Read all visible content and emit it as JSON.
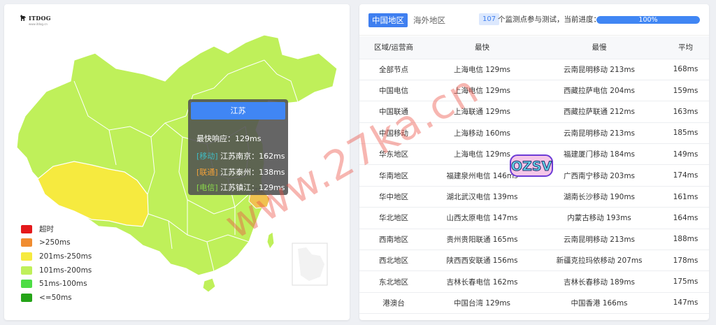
{
  "logo": {
    "name": "ITDOG",
    "sub": "www.itdog.cn"
  },
  "map": {
    "region_label": "江苏",
    "region_level_colors": {
      "default": "#bff05a",
      "tibet_qinghai": "#f6ea3f",
      "jiangsu": "#f0c250"
    }
  },
  "tooltip": {
    "title": "江苏",
    "fastest": "最快响应：129ms",
    "lines": [
      {
        "tag": "[移动]",
        "text": "江苏南京：162ms"
      },
      {
        "tag": "[联通]",
        "text": "江苏泰州：138ms"
      },
      {
        "tag": "[电信]",
        "text": "江苏镇江：129ms"
      }
    ]
  },
  "legend": [
    {
      "label": "超时",
      "color": "#e4191b"
    },
    {
      "label": ">250ms",
      "color": "#f08c30"
    },
    {
      "label": "201ms-250ms",
      "color": "#f6ea3f"
    },
    {
      "label": "101ms-200ms",
      "color": "#bff05a"
    },
    {
      "label": "51ms-100ms",
      "color": "#4ddd45"
    },
    {
      "label": "<=50ms",
      "color": "#25a418"
    }
  ],
  "tabs": {
    "china": "中国地区",
    "overseas": "海外地区"
  },
  "progress": {
    "count": "107",
    "text": "个监测点参与测试，当前进度：",
    "label": "100%",
    "value": 1.0
  },
  "table": {
    "headers": [
      "区域/运营商",
      "最快",
      "最慢",
      "平均"
    ],
    "rows": [
      [
        "全部节点",
        "上海电信 129ms",
        "云南昆明移动 213ms",
        "168ms"
      ],
      [
        "中国电信",
        "上海电信 129ms",
        "西藏拉萨电信 204ms",
        "159ms"
      ],
      [
        "中国联通",
        "上海联通 129ms",
        "西藏拉萨联通 212ms",
        "163ms"
      ],
      [
        "中国移动",
        "上海移动 160ms",
        "云南昆明移动 213ms",
        "185ms"
      ],
      [
        "华东地区",
        "上海电信 129ms",
        "福建厦门移动 184ms",
        "149ms"
      ],
      [
        "华南地区",
        "福建泉州电信 146ms",
        "广西南宁移动 203ms",
        "174ms"
      ],
      [
        "华中地区",
        "湖北武汉电信 139ms",
        "湖南长沙移动 190ms",
        "161ms"
      ],
      [
        "华北地区",
        "山西太原电信 147ms",
        "内蒙古移动 193ms",
        "164ms"
      ],
      [
        "西南地区",
        "贵州贵阳联通 165ms",
        "云南昆明移动 213ms",
        "188ms"
      ],
      [
        "西北地区",
        "陕西西安联通 156ms",
        "新疆克拉玛依移动 207ms",
        "178ms"
      ],
      [
        "东北地区",
        "吉林长春电信 162ms",
        "吉林长春移动 189ms",
        "175ms"
      ],
      [
        "港澳台",
        "中国台湾 129ms",
        "中国香港 166ms",
        "147ms"
      ]
    ]
  },
  "watermark": {
    "text": "www.27ka.cn",
    "sticker": "OZSV"
  }
}
